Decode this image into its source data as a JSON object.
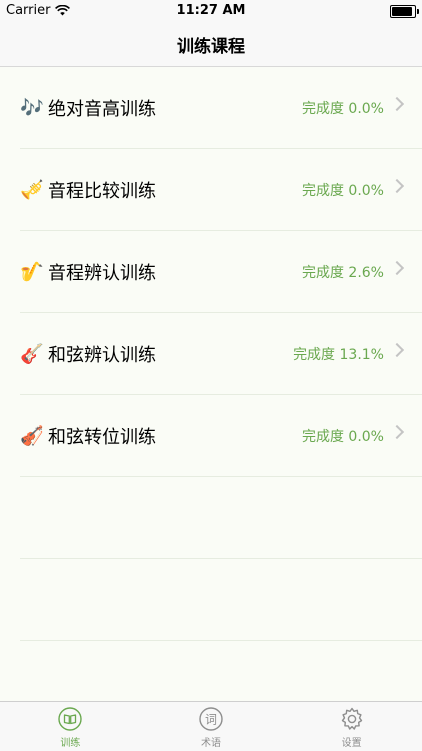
{
  "status_bar": {
    "carrier": "Carrier",
    "time": "11:27 AM",
    "battery_level": 1.0
  },
  "nav": {
    "title": "训练课程"
  },
  "rows": [
    {
      "icon": "🎶",
      "icon_name": "music-notes-icon",
      "title": "绝对音高训练",
      "progress": "完成度 0.0%"
    },
    {
      "icon": "🎺",
      "icon_name": "trumpet-icon",
      "title": "音程比较训练",
      "progress": "完成度 0.0%"
    },
    {
      "icon": "🎷",
      "icon_name": "saxophone-icon",
      "title": "音程辨认训练",
      "progress": "完成度 2.6%"
    },
    {
      "icon": "🎸",
      "icon_name": "guitar-icon",
      "title": "和弦辨认训练",
      "progress": "完成度 13.1%"
    },
    {
      "icon": "🎻",
      "icon_name": "violin-icon",
      "title": "和弦转位训练",
      "progress": "完成度 0.0%"
    }
  ],
  "tabs": [
    {
      "label": "训练",
      "icon_name": "book-icon",
      "active": true
    },
    {
      "label": "术语",
      "icon_name": "dictionary-icon",
      "active": false
    },
    {
      "label": "设置",
      "icon_name": "gear-icon",
      "active": false
    }
  ],
  "colors": {
    "accent": "#6aa84f",
    "inactive": "#8e8e8e",
    "background": "#fafcf6"
  }
}
